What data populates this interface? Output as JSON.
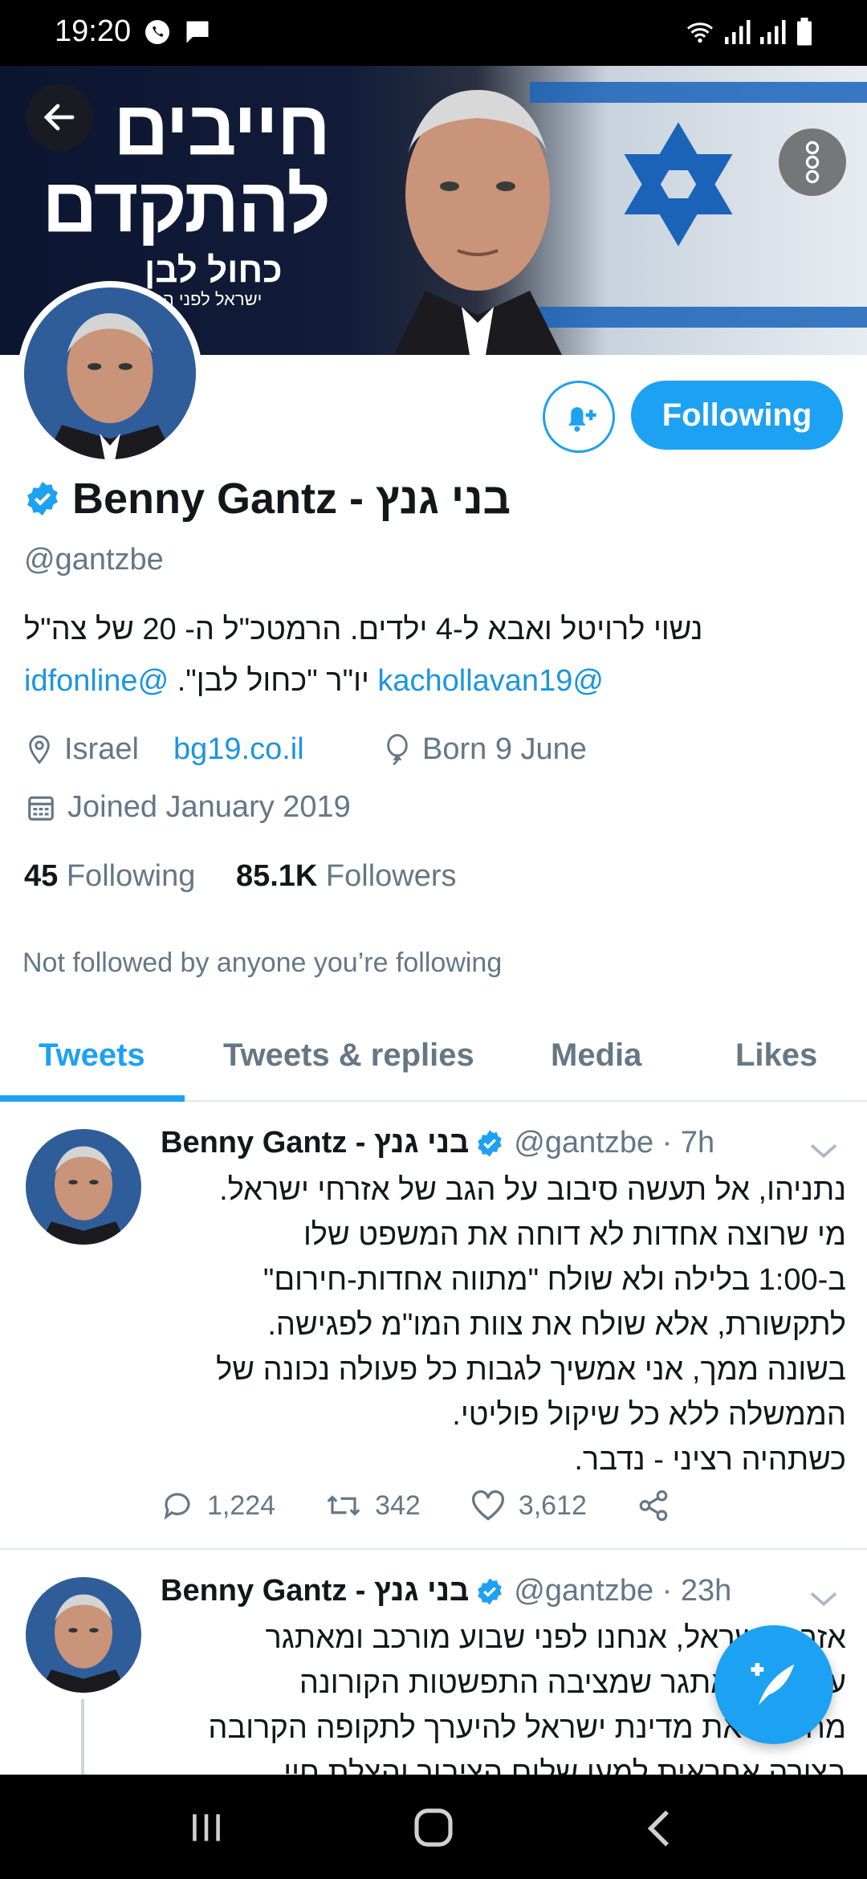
{
  "status_bar": {
    "time": "19:20"
  },
  "banner": {
    "slogan_line1": "חייבים",
    "slogan_line2": "להתקדם",
    "party_name": "כחול לבן",
    "party_tagline": "ישראל לפני הכל"
  },
  "profile": {
    "name": "Benny Gantz - בני גנץ",
    "handle": "@gantzbe",
    "bio_line1": "נשוי לרויטל ואבא ל-4 ילדים. הרמטכ\"ל ה- 20 של צה\"ל",
    "bio_line2_link1": "@kachollavan19",
    "bio_line2_text": " יו\"ר \"כחול לבן\". ",
    "bio_line2_link2": "@idfonline",
    "location": "Israel",
    "website": "bg19.co.il",
    "born": "Born 9 June",
    "joined": "Joined January 2019",
    "following_count": "45",
    "following_label": "Following",
    "followers_count": "85.1K",
    "followers_label": "Followers",
    "not_followed_text": "Not followed by anyone you’re following",
    "follow_button": "Following"
  },
  "tabs": [
    "Tweets",
    "Tweets & replies",
    "Media",
    "Likes"
  ],
  "tweets": [
    {
      "name": "Benny Gantz - בני גנץ",
      "handle_time": "@gantzbe · 7h",
      "lines": [
        "נתניהו, אל תעשה סיבוב על הגב של אזרחי ישראל.",
        "מי שרוצה אחדות לא דוחה את המשפט שלו",
        "ב-1:00 בלילה ולא שולח \"מתווה אחדות-חירום\"",
        "לתקשורת, אלא שולח את צוות המו\"מ לפגישה.",
        "בשונה ממך, אני אמשיך לגבות כל פעולה נכונה של",
        "הממשלה ללא כל שיקול פוליטי.",
        "כשתהיה רציני - נדבר."
      ],
      "replies": "1,224",
      "retweets": "342",
      "likes": "3,612"
    },
    {
      "name": "Benny Gantz - בני גנץ",
      "handle_time": "@gantzbe · 23h",
      "lines": [
        "אזרחי ישראל, אנחנו לפני שבוע מורכב ומאתגר",
        "עבורנו. האתגר שמציבה התפשטות הקורונה",
        "מחייבת את מדינת ישראל להיערך לתקופה הקרובה",
        "בצורה אחראית למען שלום הציבור והצלת חיי"
      ]
    }
  ]
}
